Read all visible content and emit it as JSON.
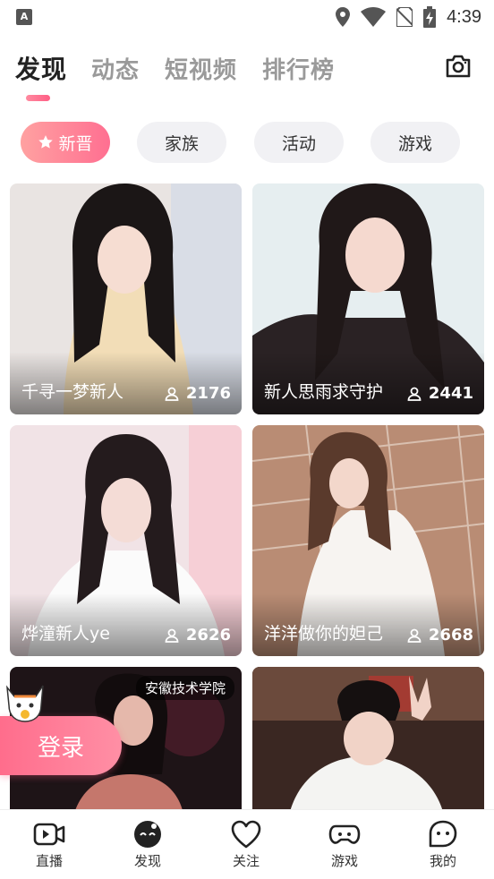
{
  "status_bar": {
    "time": "4:39",
    "app_badge": "A"
  },
  "top_tabs": [
    {
      "label": "发现",
      "active": true
    },
    {
      "label": "动态",
      "active": false
    },
    {
      "label": "短视频",
      "active": false
    },
    {
      "label": "排行榜",
      "active": false
    }
  ],
  "chips": [
    {
      "label": "新晋",
      "active": true
    },
    {
      "label": "家族",
      "active": false
    },
    {
      "label": "活动",
      "active": false
    },
    {
      "label": "游戏",
      "active": false
    }
  ],
  "cards": [
    {
      "title": "千寻一梦新人",
      "viewers": "2176"
    },
    {
      "title": "新人思雨求守护",
      "viewers": "2441"
    },
    {
      "title": "烨潼新人ye",
      "viewers": "2626"
    },
    {
      "title": "洋洋做你的妲己",
      "viewers": "2668"
    },
    {
      "title": "",
      "viewers": "",
      "tag": "安徽技术学院"
    },
    {
      "title": "",
      "viewers": ""
    }
  ],
  "login_button": "登录",
  "bottom_nav": [
    {
      "label": "直播",
      "icon": "live-video-icon"
    },
    {
      "label": "发现",
      "icon": "discover-face-icon"
    },
    {
      "label": "关注",
      "icon": "heart-icon"
    },
    {
      "label": "游戏",
      "icon": "gamepad-icon"
    },
    {
      "label": "我的",
      "icon": "profile-ghost-icon"
    }
  ],
  "colors": {
    "accent": "#ff6f91",
    "accent_light": "#ffa1a1",
    "chip_bg": "#f1f1f4"
  }
}
